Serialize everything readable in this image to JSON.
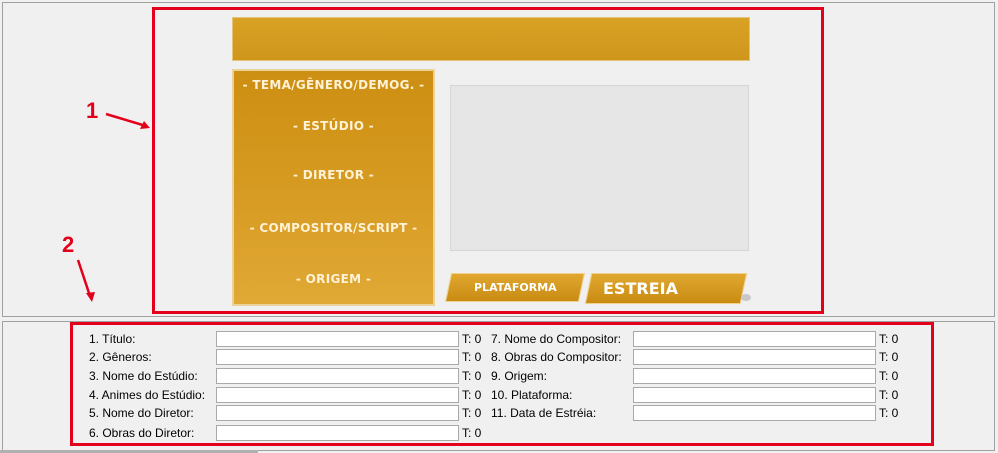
{
  "annotations": {
    "label_1": "1",
    "label_2": "2",
    "highlight_color": "#e3001b"
  },
  "preview": {
    "menu_items": [
      "- TEMA/GÊNERO/DEMOG. -",
      "- ESTÚDIO -",
      "- DIRETOR -",
      "- COMPOSITOR/SCRIPT -",
      "- ORIGEM -"
    ],
    "platform_label": "PLATAFORMA",
    "premiere_label": "ESTREIA",
    "accent_color": "#d39a1f"
  },
  "form": {
    "left": [
      {
        "label": "1. Título:",
        "value": "",
        "count": "T: 0"
      },
      {
        "label": "2. Gêneros:",
        "value": "",
        "count": "T: 0"
      },
      {
        "label": "3. Nome do Estúdio:",
        "value": "",
        "count": "T: 0"
      },
      {
        "label": "4. Animes do Estúdio:",
        "value": "",
        "count": "T: 0"
      },
      {
        "label": "5. Nome do Diretor:",
        "value": "",
        "count": "T: 0"
      },
      {
        "label": "6. Obras do Diretor:",
        "value": "",
        "count": "T: 0"
      }
    ],
    "right": [
      {
        "label": "7. Nome do Compositor:",
        "value": "",
        "count": "T: 0"
      },
      {
        "label": "8. Obras do Compositor:",
        "value": "",
        "count": "T: 0"
      },
      {
        "label": "9. Origem:",
        "value": "",
        "count": "T: 0"
      },
      {
        "label": "10. Plataforma:",
        "value": "",
        "count": "T: 0"
      },
      {
        "label": "11. Data de Estréia:",
        "value": "",
        "count": "T: 0"
      }
    ]
  }
}
